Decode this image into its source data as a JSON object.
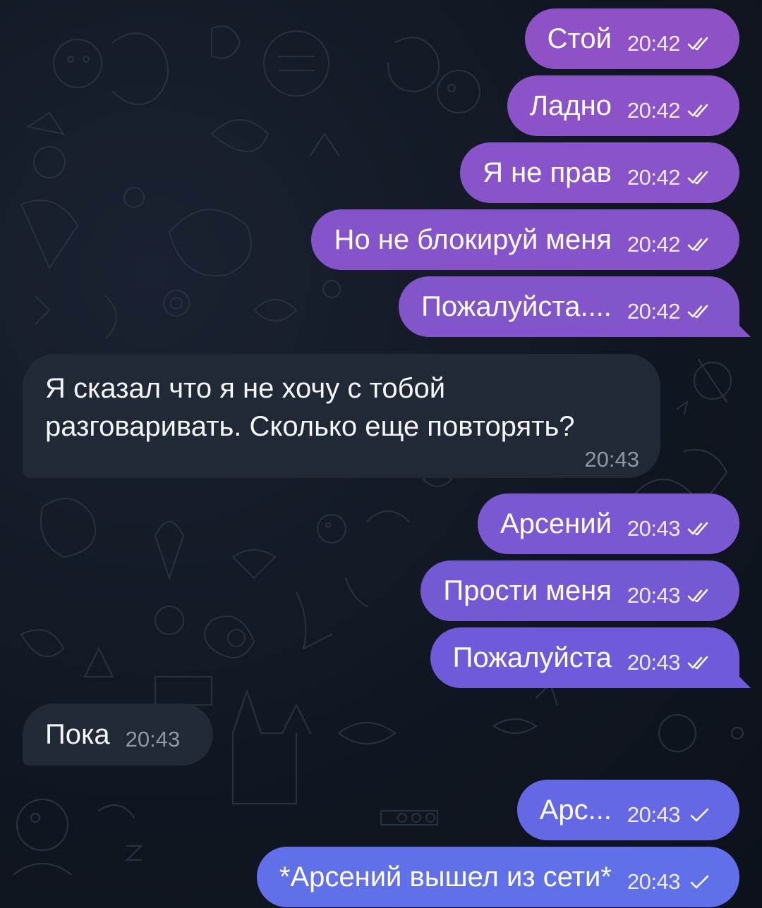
{
  "theme": {
    "background": "#111722",
    "incoming_bubble": "#212936",
    "outgoing_gradient_top": "#8a55c6",
    "outgoing_gradient_bottom": "#5f6fe8",
    "read_check_icon": "double-check-icon",
    "sent_check_icon": "single-check-icon"
  },
  "messages": [
    {
      "direction": "out",
      "text": "Стой",
      "time": "20:42",
      "status": "read"
    },
    {
      "direction": "out",
      "text": "Ладно",
      "time": "20:42",
      "status": "read"
    },
    {
      "direction": "out",
      "text": "Я не прав",
      "time": "20:42",
      "status": "read"
    },
    {
      "direction": "out",
      "text": "Но не блокируй меня",
      "time": "20:42",
      "status": "read"
    },
    {
      "direction": "out",
      "text": "Пожалуйста....",
      "time": "20:42",
      "status": "read"
    },
    {
      "direction": "in",
      "text": "Я сказал что я не хочу с тобой разговаривать. Сколько еще повторять?",
      "time": "20:43"
    },
    {
      "direction": "out",
      "text": "Арсений",
      "time": "20:43",
      "status": "read"
    },
    {
      "direction": "out",
      "text": "Прости меня",
      "time": "20:43",
      "status": "read"
    },
    {
      "direction": "out",
      "text": "Пожалуйста",
      "time": "20:43",
      "status": "read"
    },
    {
      "direction": "in",
      "text": "Пока",
      "time": "20:43"
    },
    {
      "direction": "out",
      "text": "Арс...",
      "time": "20:43",
      "status": "sent"
    },
    {
      "direction": "out",
      "text": "*Арсений вышел из сети*",
      "time": "20:43",
      "status": "sent"
    }
  ]
}
